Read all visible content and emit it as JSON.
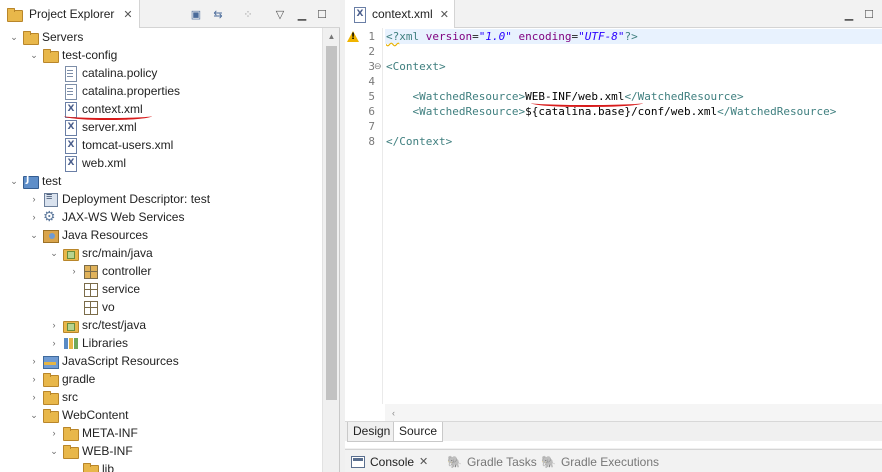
{
  "project_explorer": {
    "tab_title": "Project Explorer",
    "tree": [
      {
        "label": "Servers"
      },
      {
        "label": "test-config"
      },
      {
        "label": "catalina.policy"
      },
      {
        "label": "catalina.properties"
      },
      {
        "label": "context.xml"
      },
      {
        "label": "server.xml"
      },
      {
        "label": "tomcat-users.xml"
      },
      {
        "label": "web.xml"
      },
      {
        "label": "test"
      },
      {
        "label": "Deployment Descriptor: test"
      },
      {
        "label": "JAX-WS Web Services"
      },
      {
        "label": "Java Resources"
      },
      {
        "label": "src/main/java"
      },
      {
        "label": "controller"
      },
      {
        "label": "service"
      },
      {
        "label": "vo"
      },
      {
        "label": "src/test/java"
      },
      {
        "label": "Libraries"
      },
      {
        "label": "JavaScript Resources"
      },
      {
        "label": "gradle"
      },
      {
        "label": "src"
      },
      {
        "label": "WebContent"
      },
      {
        "label": "META-INF"
      },
      {
        "label": "WEB-INF"
      },
      {
        "label": "lib"
      }
    ]
  },
  "editor": {
    "tab_title": "context.xml",
    "line_numbers": [
      "1",
      "2",
      "3",
      "4",
      "5",
      "6",
      "7",
      "8"
    ],
    "line1": {
      "open": "<?",
      "name": "xml",
      "a1": "version",
      "v1": "\"1.0\"",
      "a2": "encoding",
      "v2": "\"UTF-8\"",
      "close": "?>"
    },
    "line3": {
      "open": "<Context>"
    },
    "line5": {
      "open": "<WatchedResource>",
      "text": "WEB-INF/web.xml",
      "close": "</WatchedResource>"
    },
    "line6": {
      "open": "<WatchedResource>",
      "text_a": "${catalina.base}",
      "text_b": "/conf/web.xml",
      "close": "</WatchedResource>"
    },
    "line8": {
      "close": "</Context>"
    },
    "subtabs": {
      "design": "Design",
      "source": "Source"
    }
  },
  "bottom_tabs": {
    "console": "Console",
    "gradle_tasks": "Gradle Tasks",
    "gradle_executions": "Gradle Executions"
  },
  "colors": {
    "annotation_red": "#d81b1b",
    "xml_tag": "#3f7f7f",
    "xml_attr": "#7f007f",
    "xml_value": "#2a00ff",
    "current_line": "#e8f2fe"
  }
}
